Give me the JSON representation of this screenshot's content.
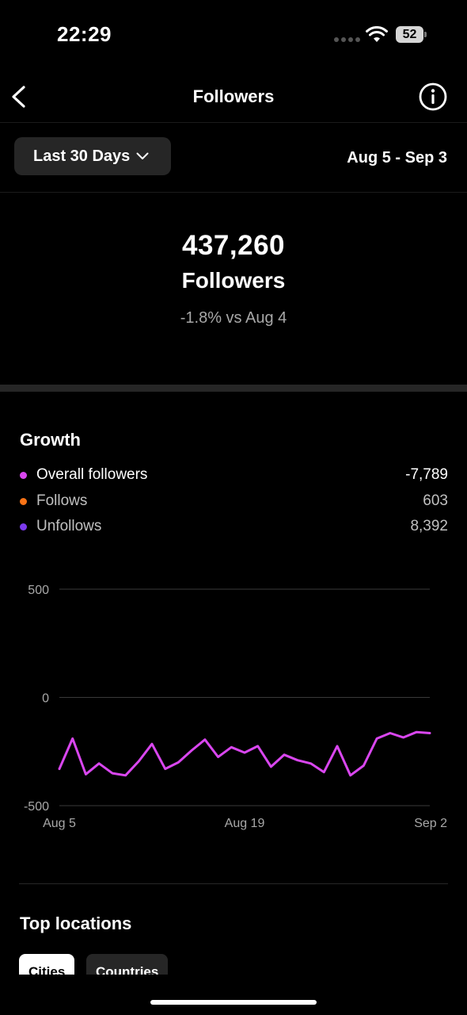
{
  "status_bar": {
    "time": "22:29",
    "battery": "52"
  },
  "nav": {
    "title": "Followers"
  },
  "filter": {
    "range_label": "Last 30 Days",
    "date_range": "Aug 5 - Sep 3"
  },
  "summary": {
    "count": "437,260",
    "label": "Followers",
    "change": "-1.8% vs Aug 4"
  },
  "growth": {
    "title": "Growth",
    "legend": [
      {
        "name": "Overall followers",
        "value": "-7,789",
        "color": "#d946ef"
      },
      {
        "name": "Follows",
        "value": "603",
        "color": "#f97316"
      },
      {
        "name": "Unfollows",
        "value": "8,392",
        "color": "#7c3aed"
      }
    ]
  },
  "chart_data": {
    "type": "line",
    "ylim": [
      -500,
      500
    ],
    "y_ticks": [
      "500",
      "0",
      "-500"
    ],
    "x_ticks": [
      "Aug 5",
      "Aug 19",
      "Sep 2"
    ],
    "grid": true,
    "series": [
      {
        "color": "#d946ef",
        "values": [
          -330,
          -190,
          -355,
          -305,
          -350,
          -360,
          -295,
          -215,
          -330,
          -300,
          -245,
          -195,
          -275,
          -230,
          -255,
          -225,
          -320,
          -265,
          -290,
          -305,
          -345,
          -225,
          -360,
          -315,
          -190,
          -165,
          -185,
          -160,
          -165
        ]
      }
    ]
  },
  "locations": {
    "title": "Top locations",
    "tabs": [
      "Cities",
      "Countries"
    ]
  },
  "colors": {
    "accent_line": "#d946ef",
    "background": "#000000",
    "chip": "#262626"
  },
  "icons": [
    "back-arrow-icon",
    "info-icon",
    "chevron-down-icon",
    "wifi-icon",
    "battery-icon"
  ]
}
